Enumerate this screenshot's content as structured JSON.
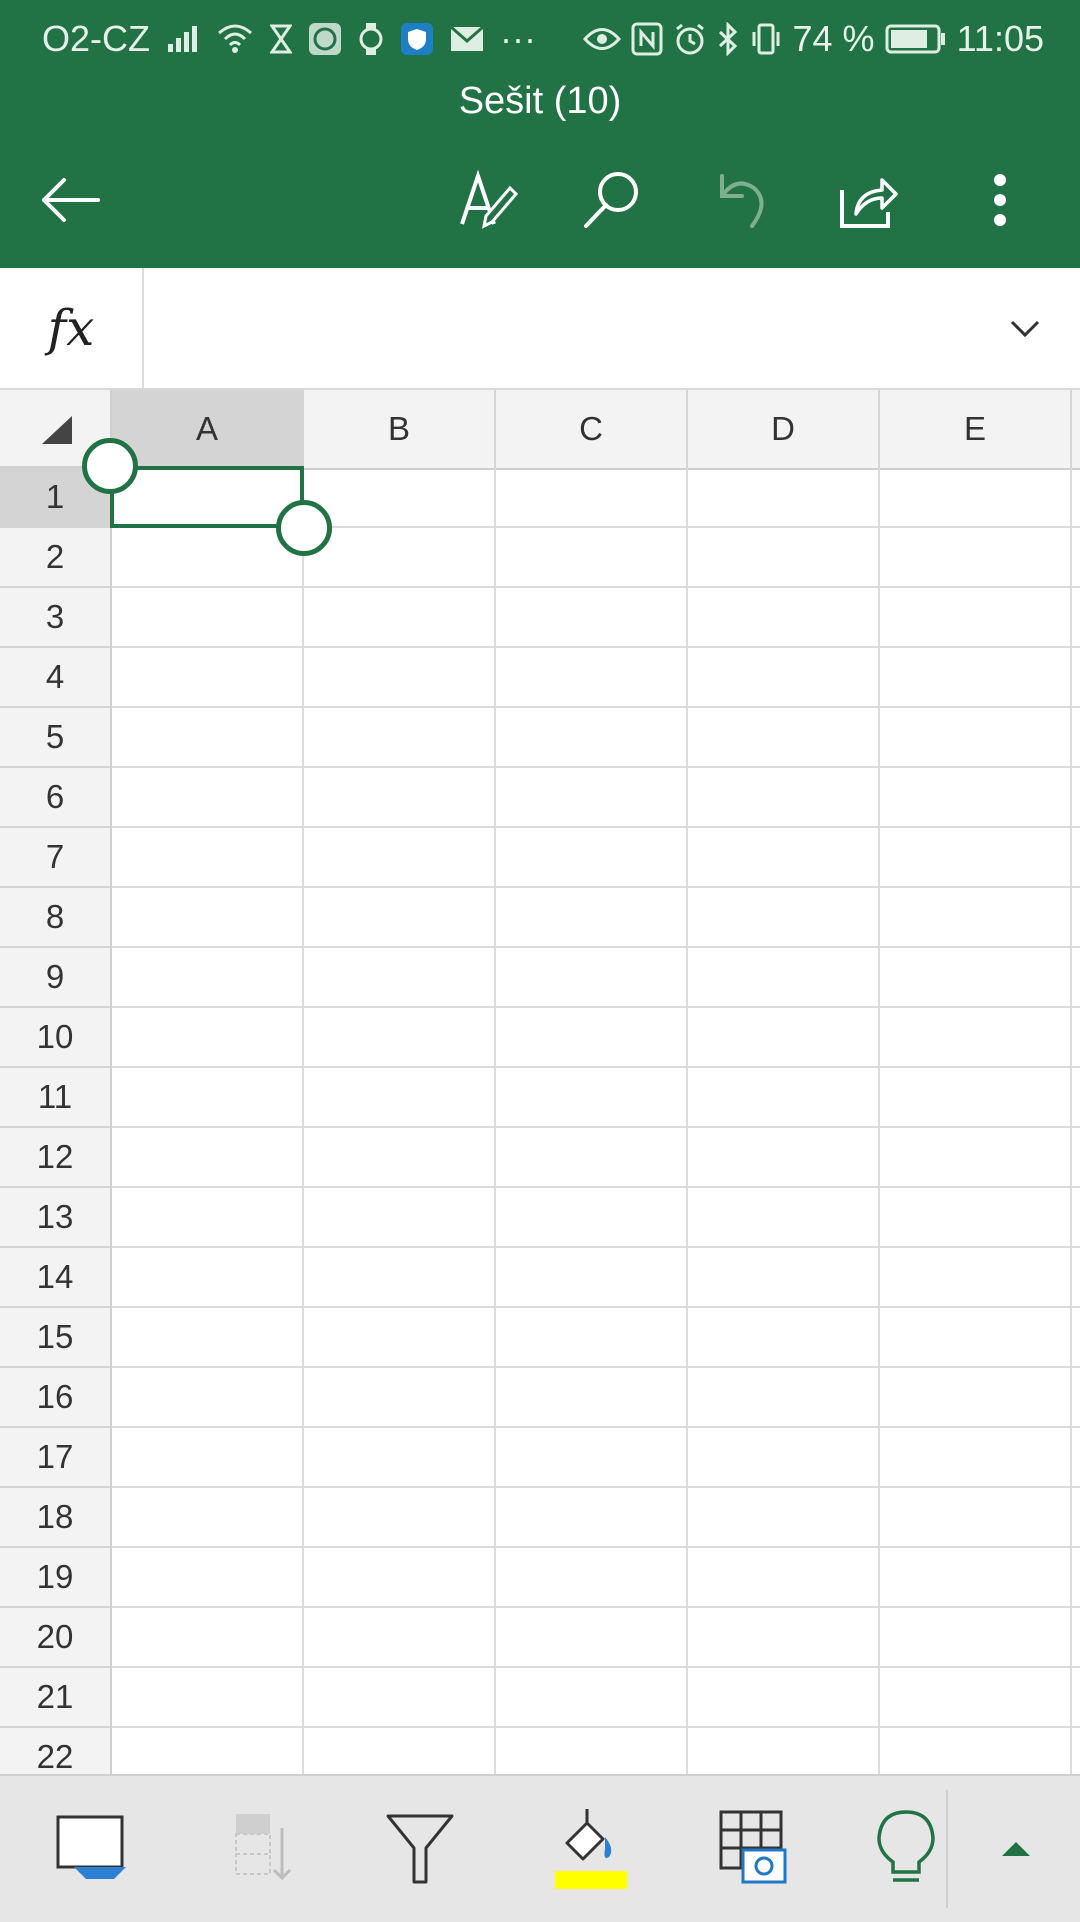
{
  "status_bar": {
    "carrier": "O2-CZ",
    "battery_percent": "74 %",
    "time": "11:05",
    "more": "···"
  },
  "app_bar": {
    "title": "Sešit (10)",
    "icons": [
      "back-arrow-icon",
      "draw-pen-icon",
      "search-icon",
      "undo-icon",
      "share-icon",
      "more-vert-icon"
    ]
  },
  "formula_bar": {
    "fx_label": "fx",
    "value": ""
  },
  "sheet": {
    "columns": [
      "A",
      "B",
      "C",
      "D",
      "E"
    ],
    "rows": [
      "1",
      "2",
      "3",
      "4",
      "5",
      "6",
      "7",
      "8",
      "9",
      "10",
      "11",
      "12",
      "13",
      "14",
      "15",
      "16",
      "17",
      "18",
      "19",
      "20",
      "21",
      "22"
    ],
    "selected_cell": "A1"
  },
  "bottom_toolbar": {
    "icons": [
      "present-screen-icon",
      "sort-icon",
      "filter-icon",
      "fill-color-icon",
      "table-snapshot-icon",
      "lightbulb-icon",
      "expand-up-icon"
    ],
    "accent_colors": {
      "fill": "#ffff00",
      "brand": "#217346"
    }
  }
}
